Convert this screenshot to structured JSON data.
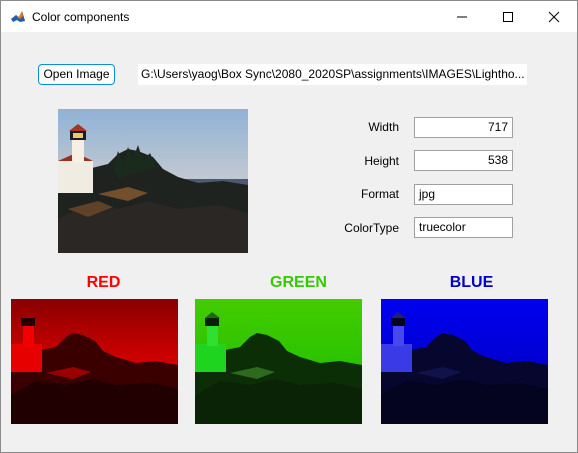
{
  "window": {
    "title": "Color components",
    "icon": "matlab-icon"
  },
  "toolbar": {
    "open_label": "Open Image",
    "path": "G:\\Users\\yaog\\Box Sync\\2080_2020SP\\assignments\\IMAGES\\Lightho..."
  },
  "properties": {
    "width": {
      "label": "Width",
      "value": "717"
    },
    "height": {
      "label": "Height",
      "value": "538"
    },
    "format": {
      "label": "Format",
      "value": "jpg"
    },
    "colortype": {
      "label": "ColorType",
      "value": "truecolor"
    }
  },
  "channels": [
    {
      "label": "RED",
      "color": "#ff0000"
    },
    {
      "label": "GREEN",
      "color": "#33cc00"
    },
    {
      "label": "BLUE",
      "color": "#0000cc"
    }
  ],
  "colors": {
    "title_bar": "#ffffff",
    "background": "#f0f0f0",
    "button_border": "#0d8fd6"
  }
}
